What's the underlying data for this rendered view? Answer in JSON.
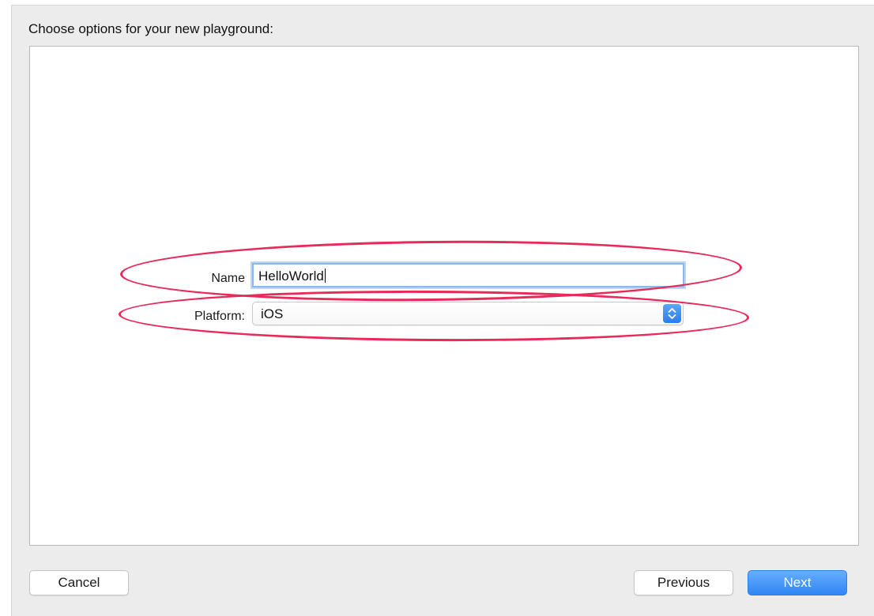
{
  "dialog": {
    "title": "Choose options for your new playground:"
  },
  "form": {
    "name": {
      "label": "Name",
      "value": "HelloWorld"
    },
    "platform": {
      "label": "Platform:",
      "selected": "iOS"
    }
  },
  "buttons": {
    "cancel": "Cancel",
    "previous": "Previous",
    "next": "Next"
  },
  "colors": {
    "highlight": "#e8295a",
    "primary": "#2f86f5",
    "focus_ring": "#8fb8ea"
  },
  "icons": {
    "platform_stepper": "up-down-chevron-icon"
  }
}
